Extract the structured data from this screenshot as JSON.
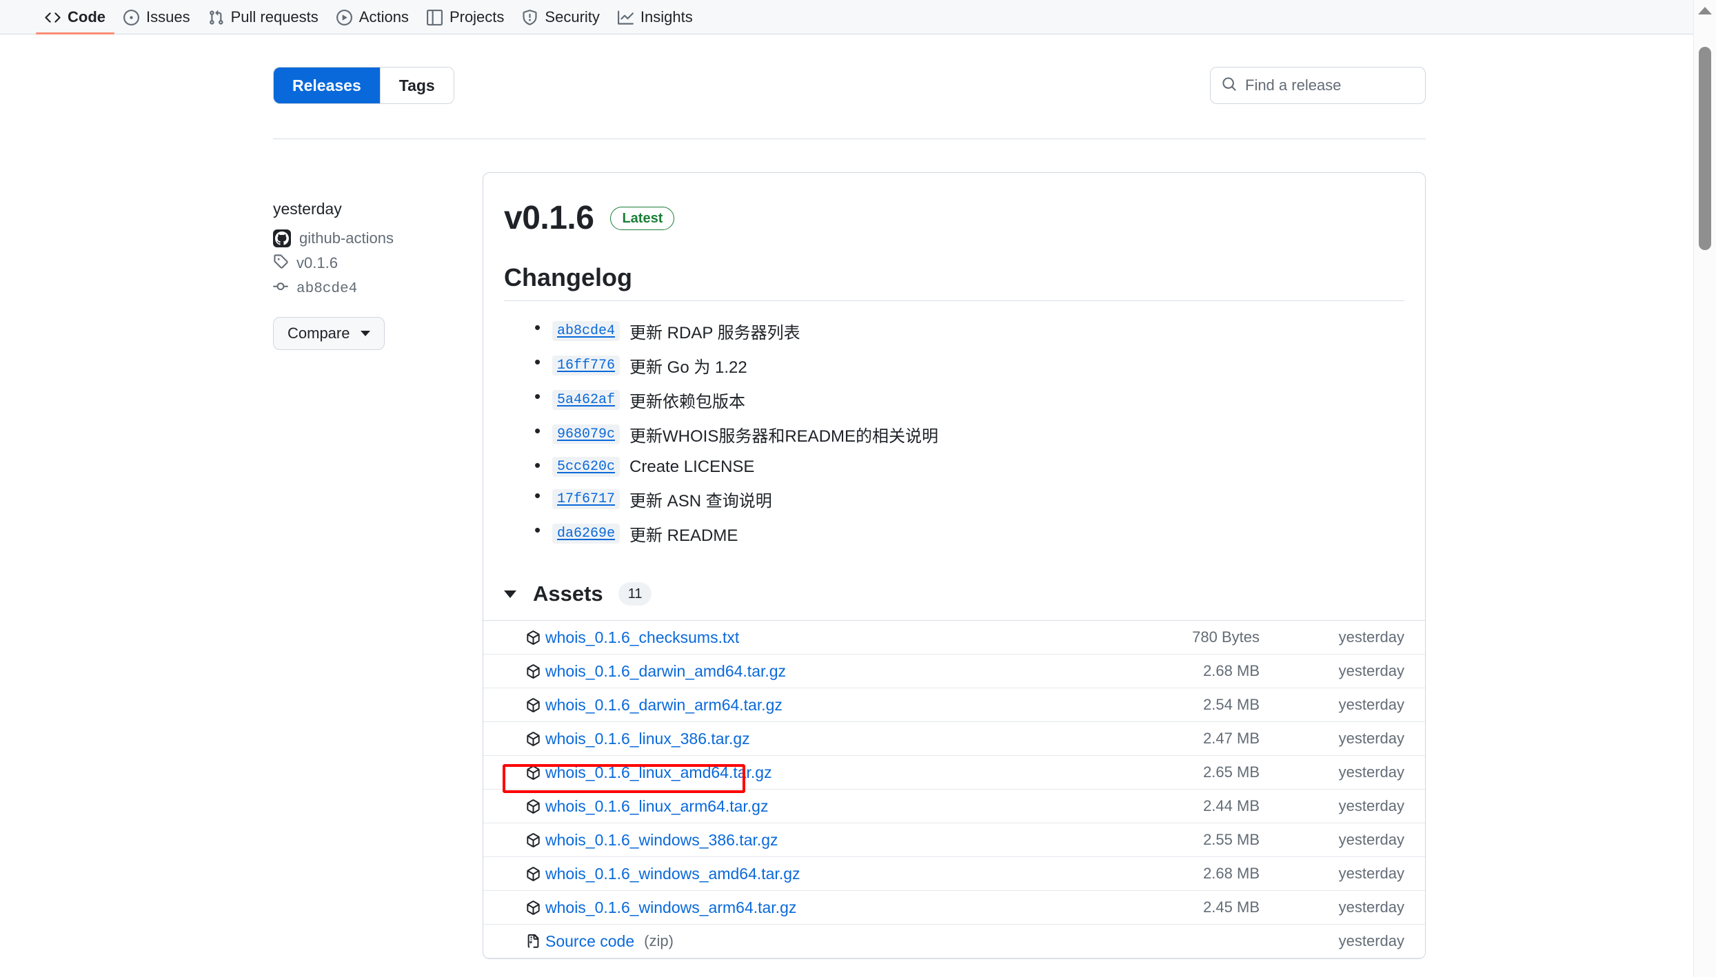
{
  "repo_nav": {
    "items": [
      {
        "label": "Code",
        "icon": "code-icon",
        "active": true
      },
      {
        "label": "Issues",
        "icon": "issue-opened-icon",
        "active": false
      },
      {
        "label": "Pull requests",
        "icon": "git-pull-request-icon",
        "active": false
      },
      {
        "label": "Actions",
        "icon": "play-icon",
        "active": false
      },
      {
        "label": "Projects",
        "icon": "table-icon",
        "active": false
      },
      {
        "label": "Security",
        "icon": "shield-icon",
        "active": false
      },
      {
        "label": "Insights",
        "icon": "graph-icon",
        "active": false
      }
    ]
  },
  "toolbar": {
    "tabs": [
      {
        "label": "Releases",
        "active": true
      },
      {
        "label": "Tags",
        "active": false
      }
    ],
    "search_placeholder": "Find a release",
    "search_value": ""
  },
  "sidebar": {
    "date": "yesterday",
    "author": "github-actions",
    "tag": "v0.1.6",
    "commit": "ab8cde4",
    "compare_label": "Compare"
  },
  "release": {
    "version": "v0.1.6",
    "latest_badge": "Latest",
    "changelog_heading": "Changelog",
    "changelog": [
      {
        "sha": "ab8cde4",
        "message": "更新 RDAP 服务器列表"
      },
      {
        "sha": "16ff776",
        "message": "更新 Go 为 1.22"
      },
      {
        "sha": "5a462af",
        "message": "更新依赖包版本"
      },
      {
        "sha": "968079c",
        "message": "更新WHOIS服务器和README的相关说明"
      },
      {
        "sha": "5cc620c",
        "message": "Create LICENSE"
      },
      {
        "sha": "17f6717",
        "message": "更新 ASN 查询说明"
      },
      {
        "sha": "da6269e",
        "message": "更新 README"
      }
    ]
  },
  "assets": {
    "title": "Assets",
    "count": "11",
    "rows": [
      {
        "icon": "package-icon",
        "name": "whois_0.1.6_checksums.txt",
        "suffix": "",
        "size": "780 Bytes",
        "time": "yesterday",
        "highlighted": false
      },
      {
        "icon": "package-icon",
        "name": "whois_0.1.6_darwin_amd64.tar.gz",
        "suffix": "",
        "size": "2.68 MB",
        "time": "yesterday",
        "highlighted": false
      },
      {
        "icon": "package-icon",
        "name": "whois_0.1.6_darwin_arm64.tar.gz",
        "suffix": "",
        "size": "2.54 MB",
        "time": "yesterday",
        "highlighted": false
      },
      {
        "icon": "package-icon",
        "name": "whois_0.1.6_linux_386.tar.gz",
        "suffix": "",
        "size": "2.47 MB",
        "time": "yesterday",
        "highlighted": false
      },
      {
        "icon": "package-icon",
        "name": "whois_0.1.6_linux_amd64.tar.gz",
        "suffix": "",
        "size": "2.65 MB",
        "time": "yesterday",
        "highlighted": true
      },
      {
        "icon": "package-icon",
        "name": "whois_0.1.6_linux_arm64.tar.gz",
        "suffix": "",
        "size": "2.44 MB",
        "time": "yesterday",
        "highlighted": false
      },
      {
        "icon": "package-icon",
        "name": "whois_0.1.6_windows_386.tar.gz",
        "suffix": "",
        "size": "2.55 MB",
        "time": "yesterday",
        "highlighted": false
      },
      {
        "icon": "package-icon",
        "name": "whois_0.1.6_windows_amd64.tar.gz",
        "suffix": "",
        "size": "2.68 MB",
        "time": "yesterday",
        "highlighted": false
      },
      {
        "icon": "package-icon",
        "name": "whois_0.1.6_windows_arm64.tar.gz",
        "suffix": "",
        "size": "2.45 MB",
        "time": "yesterday",
        "highlighted": false
      },
      {
        "icon": "file-zip-icon",
        "name": "Source code",
        "suffix": "(zip)",
        "size": "",
        "time": "yesterday",
        "highlighted": false
      }
    ]
  },
  "colors": {
    "accent": "#0969da",
    "success": "#1a7f37",
    "tab_underline": "#fd8c73",
    "annotation": "#ff0000"
  }
}
